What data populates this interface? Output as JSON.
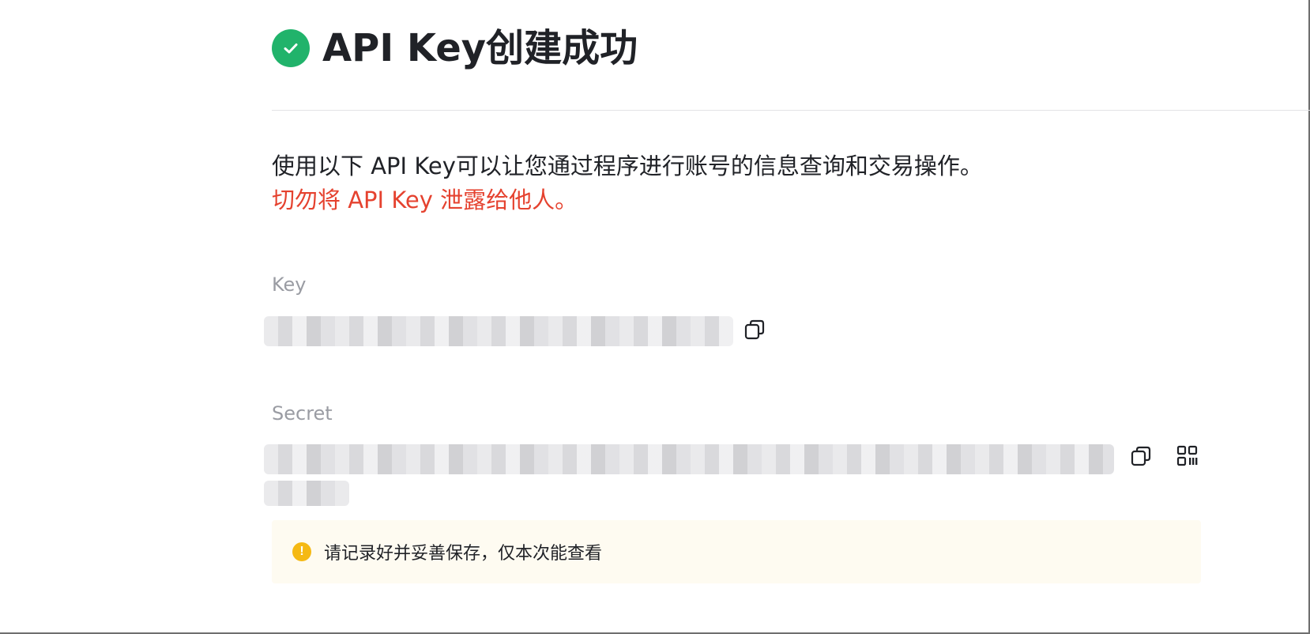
{
  "header": {
    "title": "API Key创建成功",
    "icon": "check-circle-icon",
    "icon_color": "#21b36b"
  },
  "intro": {
    "description": "使用以下 API Key可以让您通过程序进行账号的信息查询和交易操作。",
    "warning": "切勿将 API Key 泄露给他人。",
    "warning_color": "#e5422f"
  },
  "key_field": {
    "label": "Key",
    "copy_icon": "copy-icon"
  },
  "secret_field": {
    "label": "Secret",
    "copy_icon": "copy-icon",
    "qr_icon": "qr-code-icon"
  },
  "notice": {
    "icon": "exclamation-circle-icon",
    "icon_color": "#f5b914",
    "text": "请记录好并妥善保存，仅本次能查看"
  }
}
